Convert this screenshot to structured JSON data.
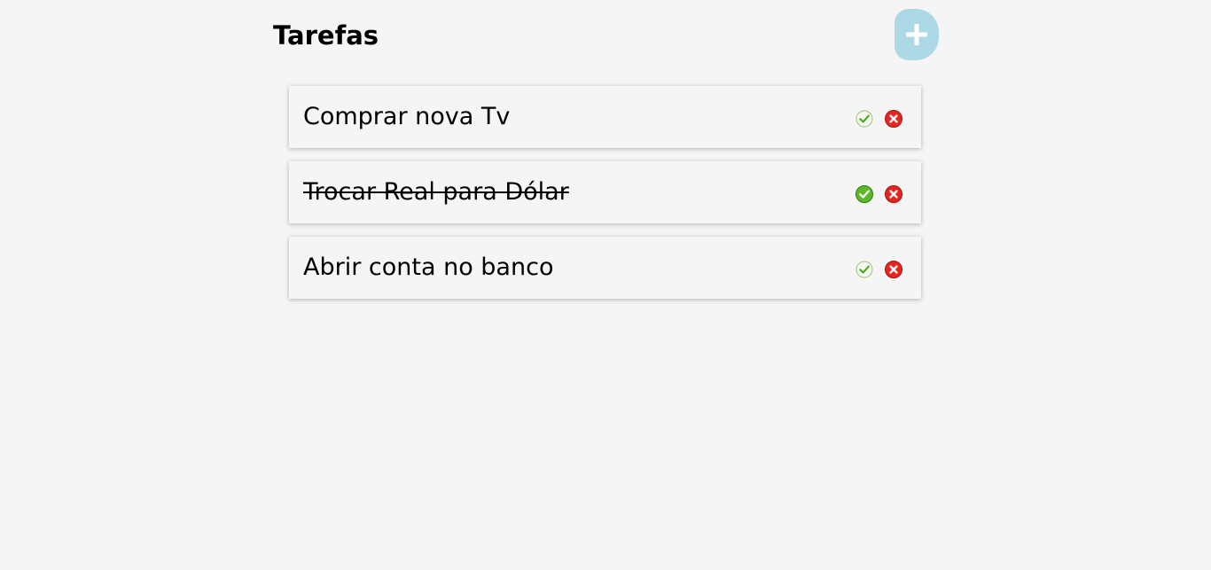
{
  "header": {
    "title": "Tarefas",
    "add_icon": "plus-icon"
  },
  "colors": {
    "background": "#f5f5f5",
    "add_button": "#add8e6",
    "check_green": "#5cb82b",
    "delete_red": "#e52521"
  },
  "tasks": [
    {
      "text": "Comprar nova Tv",
      "completed": false
    },
    {
      "text": "Trocar Real para Dólar",
      "completed": true
    },
    {
      "text": "Abrir conta no banco",
      "completed": false
    }
  ],
  "icons": {
    "complete": "check-circle-icon",
    "delete": "x-circle-icon"
  }
}
